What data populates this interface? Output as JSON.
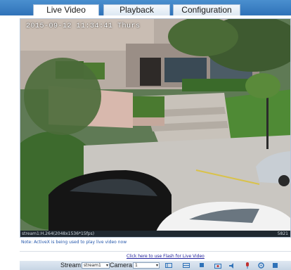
{
  "tabs": [
    {
      "label": "Live Video",
      "active": true
    },
    {
      "label": "Playback",
      "active": false
    },
    {
      "label": "Configuration",
      "active": false
    }
  ],
  "video": {
    "osd_timestamp": "2015-09-12 11:34:41 Thurs",
    "status_left": "stream1:H.264(2048x1536*15fps)",
    "status_right": "5821"
  },
  "note": "Note: ActiveX is being used to play live video now",
  "flash_link": "Click here to use Flash for Live Video",
  "controls": {
    "stream_label": "Stream",
    "stream_value": "stream1",
    "camera_label": "Camera",
    "camera_value": "1"
  },
  "toolbar_icons": [
    "ptz-icon",
    "layout-icon",
    "stop-icon",
    "snapshot-icon",
    "speaker-icon",
    "mic-icon",
    "settings-icon",
    "record-icon"
  ],
  "colors": {
    "accent": "#2f72b8",
    "link": "#2255aa"
  }
}
